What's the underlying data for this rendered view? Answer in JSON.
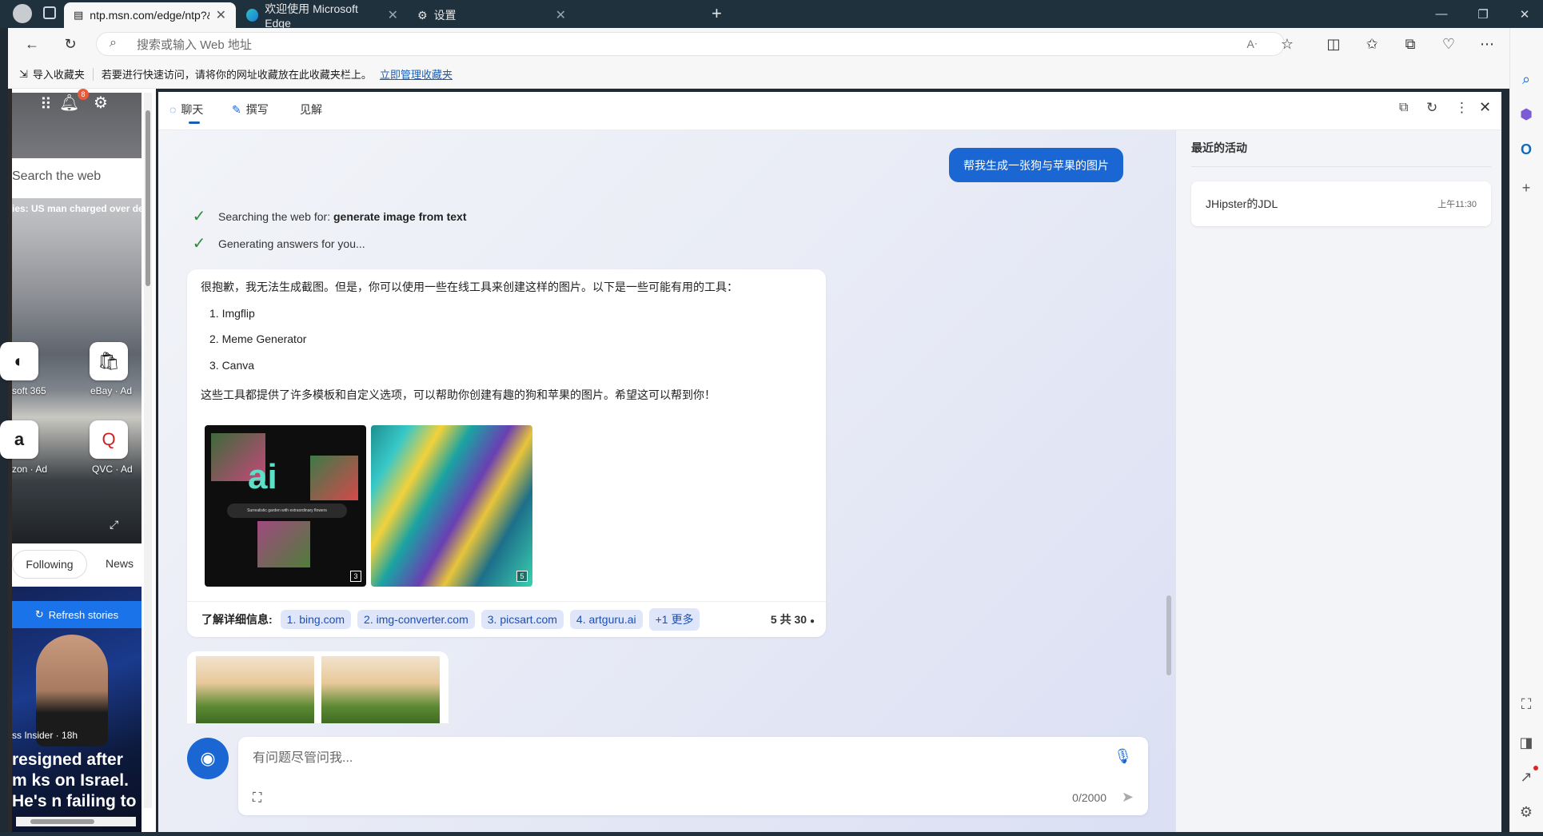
{
  "tabs": [
    {
      "title": "ntp.msn.com/edge/ntp?&form=",
      "active": true
    },
    {
      "title": "欢迎使用 Microsoft Edge",
      "active": false
    },
    {
      "title": "设置",
      "active": false
    }
  ],
  "address_bar": {
    "placeholder": "搜索或输入 Web 地址"
  },
  "favorites_bar": {
    "import_label": "导入收藏夹",
    "hint": "若要进行快速访问，请将你的网址收藏放在此收藏夹栏上。",
    "manage_link": "立即管理收藏夹"
  },
  "background_page": {
    "notification_count": "8",
    "search_placeholder": "Search the web",
    "headline_snippet": "ies: US man charged over de",
    "tiles": [
      {
        "label": "soft 365"
      },
      {
        "label": "eBay · Ad"
      },
      {
        "label": "zon · Ad"
      },
      {
        "label": "QVC · Ad"
      }
    ],
    "tab_following": "Following",
    "tab_news": "News",
    "refresh_stories": "Refresh stories",
    "story_source": "ss Insider · 18h",
    "story_headline": "resigned after m ks on Israel. He's n failing to read"
  },
  "copilot": {
    "tabs": [
      {
        "label": "聊天",
        "active": true
      },
      {
        "label": "撰写",
        "active": false
      },
      {
        "label": "见解",
        "active": false
      }
    ],
    "user_message": "帮我生成一张狗与苹果的图片",
    "status": {
      "searching_prefix": "Searching the web for: ",
      "searching_query": "generate image from text",
      "generating": "Generating answers for you..."
    },
    "answer": {
      "intro": "很抱歉，我无法生成截图。但是，你可以使用一些在线工具来创建这样的图片。以下是一些可能有用的工具：",
      "items": [
        "1. Imgflip",
        "2. Meme Generator",
        "3. Canva"
      ],
      "outro": "这些工具都提供了许多模板和自定义选项，可以帮助你创建有趣的狗和苹果的图片。希望这可以帮到你！",
      "image_1_badge": "3",
      "image_1_logo": "ai",
      "image_1_caption": "Surrealistic garden with extraordinary flowers",
      "image_2_badge": "5"
    },
    "learn_more": {
      "label": "了解详细信息:",
      "sources": [
        "1. bing.com",
        "2. img-converter.com",
        "3. picsart.com",
        "4. artguru.ai"
      ],
      "more": "+1 更多",
      "pager": "5 共 30"
    },
    "composer": {
      "placeholder": "有问题尽管问我...",
      "counter": "0/2000"
    },
    "recent": {
      "title": "最近的活动",
      "items": [
        {
          "title": "JHipster的JDL",
          "time": "上午11:30"
        }
      ]
    }
  },
  "colors": {
    "accent": "#1a66d2",
    "tabbar": "#20313e",
    "source_chip": "#dfe6fa",
    "check": "#2e8b3b"
  }
}
